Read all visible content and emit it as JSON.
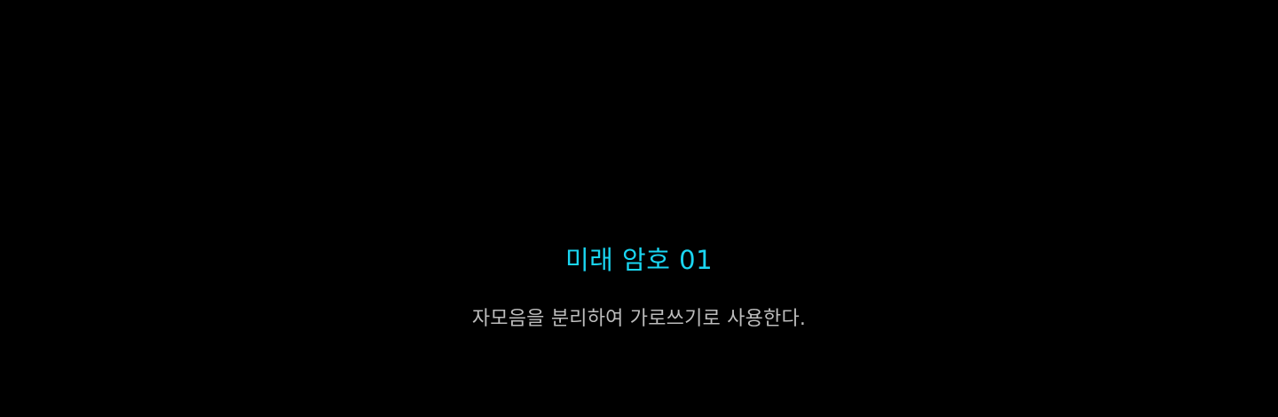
{
  "section": {
    "title": "미래 암호 01",
    "description": "자모음을 분리하여 가로쓰기로 사용한다."
  },
  "colors": {
    "background": "#000000",
    "title": "#1ad6f2",
    "description": "#bdbdbd"
  }
}
